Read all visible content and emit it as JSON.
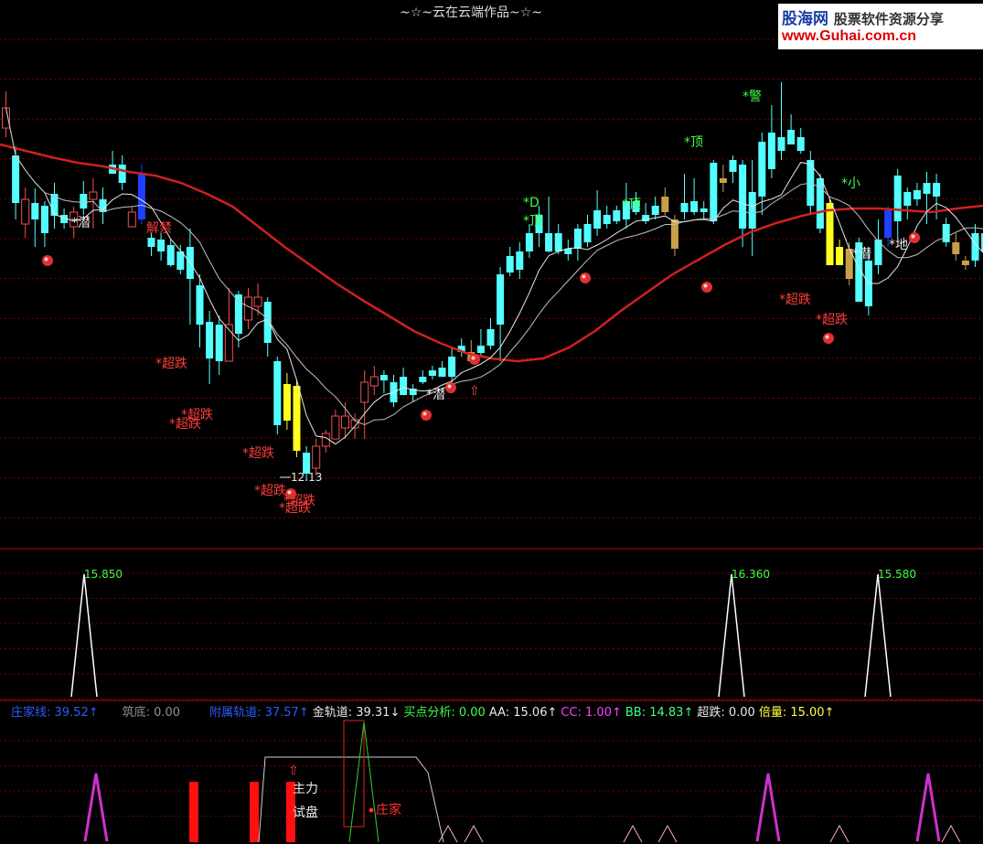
{
  "title": "~☆~云在云端作品~☆~",
  "logo": {
    "brand": "股海网",
    "tagline": "股票软件资源分享",
    "url": "www.Guhai.com.cn"
  },
  "colors": {
    "up": "#f05050",
    "down": "#54ffff",
    "ma_long": "#d02020",
    "grid": "#7a0000",
    "text_red": "#ff3c3c",
    "text_green": "#40ff40"
  },
  "chart_data": [
    {
      "type": "candlestick",
      "panel": "price",
      "min_low_label": "12.13",
      "annotations": [
        "*潜",
        "解禁",
        "*超跌",
        "*超跌",
        "*超跌",
        "*超跌",
        "*超跌",
        "*超跌",
        "*潜",
        "*D",
        "*顶",
        "*顶",
        "*警",
        "*顶",
        "*小",
        "*潜",
        "*地",
        "*超跌",
        "*超跌",
        "*超跌"
      ],
      "candles": [
        [
          140,
          118,
          100,
          150
        ],
        [
          170,
          222,
          160,
          240
        ],
        [
          245,
          218,
          205,
          260
        ],
        [
          222,
          240,
          206,
          270
        ],
        [
          225,
          255,
          220,
          270
        ],
        [
          212,
          236,
          200,
          250
        ],
        [
          235,
          244,
          228,
          250
        ],
        [
          248,
          232,
          226,
          260
        ],
        [
          212,
          228,
          198,
          235
        ],
        [
          218,
          210,
          195,
          250
        ],
        [
          218,
          232,
          205,
          245
        ],
        [
          180,
          190,
          165,
          190
        ],
        [
          180,
          200,
          170,
          208
        ],
        [
          248,
          232,
          226,
          248
        ],
        [
          190,
          240,
          180,
          245
        ],
        [
          260,
          270,
          255,
          280
        ],
        [
          262,
          275,
          255,
          285
        ],
        [
          268,
          290,
          262,
          292
        ],
        [
          275,
          295,
          268,
          300
        ],
        [
          270,
          305,
          250,
          355
        ],
        [
          312,
          355,
          300,
          380
        ],
        [
          352,
          392,
          340,
          420
        ],
        [
          355,
          395,
          345,
          410
        ],
        [
          395,
          355,
          315,
          375
        ],
        [
          322,
          365,
          318,
          380
        ],
        [
          350,
          325,
          315,
          360
        ],
        [
          335,
          325,
          310,
          345
        ],
        [
          330,
          375,
          325,
          390
        ],
        [
          395,
          465,
          390,
          475
        ],
        [
          460,
          420,
          408,
          470
        ],
        [
          422,
          493,
          415,
          500
        ],
        [
          495,
          518,
          488,
          525
        ],
        [
          512,
          488,
          480,
          520
        ],
        [
          488,
          474,
          470,
          495
        ],
        [
          480,
          455,
          448,
          480
        ],
        [
          468,
          455,
          440,
          480
        ],
        [
          468,
          459,
          452,
          480
        ],
        [
          440,
          418,
          405,
          480
        ],
        [
          422,
          412,
          400,
          432
        ],
        [
          410,
          416,
          405,
          430
        ],
        [
          418,
          440,
          410,
          445
        ],
        [
          412,
          432,
          402,
          432
        ],
        [
          425,
          432,
          420,
          440
        ],
        [
          412,
          418,
          405,
          420
        ],
        [
          405,
          411,
          400,
          415
        ],
        [
          402,
          412,
          395,
          412
        ],
        [
          390,
          412,
          380,
          430
        ],
        [
          378,
          385,
          370,
          390
        ],
        [
          385,
          395,
          372,
          395
        ],
        [
          378,
          386,
          360,
          390
        ],
        [
          360,
          378,
          348,
          382
        ],
        [
          300,
          355,
          292,
          395
        ],
        [
          280,
          298,
          270,
          302
        ],
        [
          275,
          295,
          265,
          305
        ],
        [
          255,
          275,
          245,
          282
        ],
        [
          235,
          255,
          225,
          270
        ],
        [
          255,
          275,
          215,
          276
        ],
        [
          255,
          275,
          245,
          278
        ],
        [
          272,
          278,
          262,
          285
        ],
        [
          250,
          272,
          245,
          285
        ],
        [
          245,
          265,
          235,
          270
        ],
        [
          230,
          250,
          208,
          258
        ],
        [
          235,
          245,
          225,
          250
        ],
        [
          230,
          242,
          225,
          245
        ],
        [
          220,
          240,
          200,
          250
        ],
        [
          220,
          232,
          210,
          235
        ],
        [
          235,
          242,
          222,
          245
        ],
        [
          225,
          235,
          215,
          240
        ],
        [
          215,
          232,
          205,
          235
        ],
        [
          240,
          272,
          235,
          280
        ],
        [
          222,
          232,
          190,
          240
        ],
        [
          220,
          232,
          195,
          235
        ],
        [
          228,
          232,
          220,
          240
        ],
        [
          178,
          242,
          175,
          245
        ],
        [
          195,
          200,
          180,
          210
        ],
        [
          175,
          188,
          170,
          200
        ],
        [
          180,
          250,
          175,
          270
        ],
        [
          210,
          250,
          175,
          280
        ],
        [
          155,
          215,
          145,
          235
        ],
        [
          145,
          185,
          115,
          195
        ],
        [
          150,
          165,
          90,
          175
        ],
        [
          142,
          158,
          125,
          158
        ],
        [
          150,
          165,
          140,
          168
        ],
        [
          175,
          225,
          165,
          235
        ],
        [
          195,
          250,
          190,
          255
        ],
        [
          222,
          290,
          218,
          290
        ],
        [
          270,
          290,
          262,
          290
        ],
        [
          272,
          305,
          265,
          312
        ],
        [
          265,
          330,
          260,
          330
        ],
        [
          285,
          335,
          275,
          345
        ],
        [
          262,
          290,
          240,
          300
        ],
        [
          230,
          260,
          225,
          270
        ],
        [
          192,
          242,
          185,
          260
        ],
        [
          210,
          225,
          205,
          240
        ],
        [
          208,
          218,
          200,
          225
        ],
        [
          200,
          212,
          188,
          245
        ],
        [
          200,
          215,
          190,
          240
        ],
        [
          245,
          265,
          238,
          270
        ],
        [
          265,
          278,
          255,
          285
        ],
        [
          285,
          290,
          280,
          295
        ],
        [
          255,
          285,
          245,
          292
        ],
        [
          255,
          275,
          250,
          282
        ]
      ],
      "ma_long": [
        158,
        165,
        172,
        178,
        182,
        188,
        192,
        200,
        212,
        226,
        248,
        270,
        290,
        310,
        328,
        345,
        362,
        375,
        386,
        392,
        395,
        392,
        380,
        362,
        340,
        320,
        300,
        284,
        268,
        254,
        244,
        236,
        230,
        228,
        228,
        230,
        232,
        228,
        225
      ]
    },
    {
      "type": "line",
      "panel": "peak",
      "peaks": [
        {
          "label": "15.850"
        },
        {
          "label": "16.360"
        },
        {
          "label": "15.580"
        }
      ]
    },
    {
      "type": "indicator",
      "panel": "lower",
      "stats": [
        {
          "label": "庄家线:",
          "value": "39.52",
          "arrow": "↑",
          "color": "#2a5cff"
        },
        {
          "label": "筑底:",
          "value": "0.00",
          "arrow": "",
          "color": "#909090"
        },
        {
          "label": "附属轨道:",
          "value": "37.57",
          "arrow": "↑",
          "color": "#2a5cff"
        },
        {
          "label": "金轨道:",
          "value": "39.31",
          "arrow": "↓",
          "color": "#e8e8e8"
        },
        {
          "label": "买点分析:",
          "value": "0.00",
          "arrow": "",
          "color": "#40ff40"
        },
        {
          "label": "AA:",
          "value": "15.06",
          "arrow": "↑",
          "color": "#e8e8e8"
        },
        {
          "label": "CC:",
          "value": "1.00",
          "arrow": "↑",
          "color": "#ff40ff"
        },
        {
          "label": "BB:",
          "value": "14.83",
          "arrow": "↑",
          "color": "#40ff80"
        },
        {
          "label": "超跌:",
          "value": "0.00",
          "arrow": "",
          "color": "#e8e8e8"
        },
        {
          "label": "倍量:",
          "value": "15.00",
          "arrow": "↑",
          "color": "#ffff40"
        }
      ],
      "labels": [
        "主力",
        "试盘",
        "庄家"
      ]
    }
  ]
}
